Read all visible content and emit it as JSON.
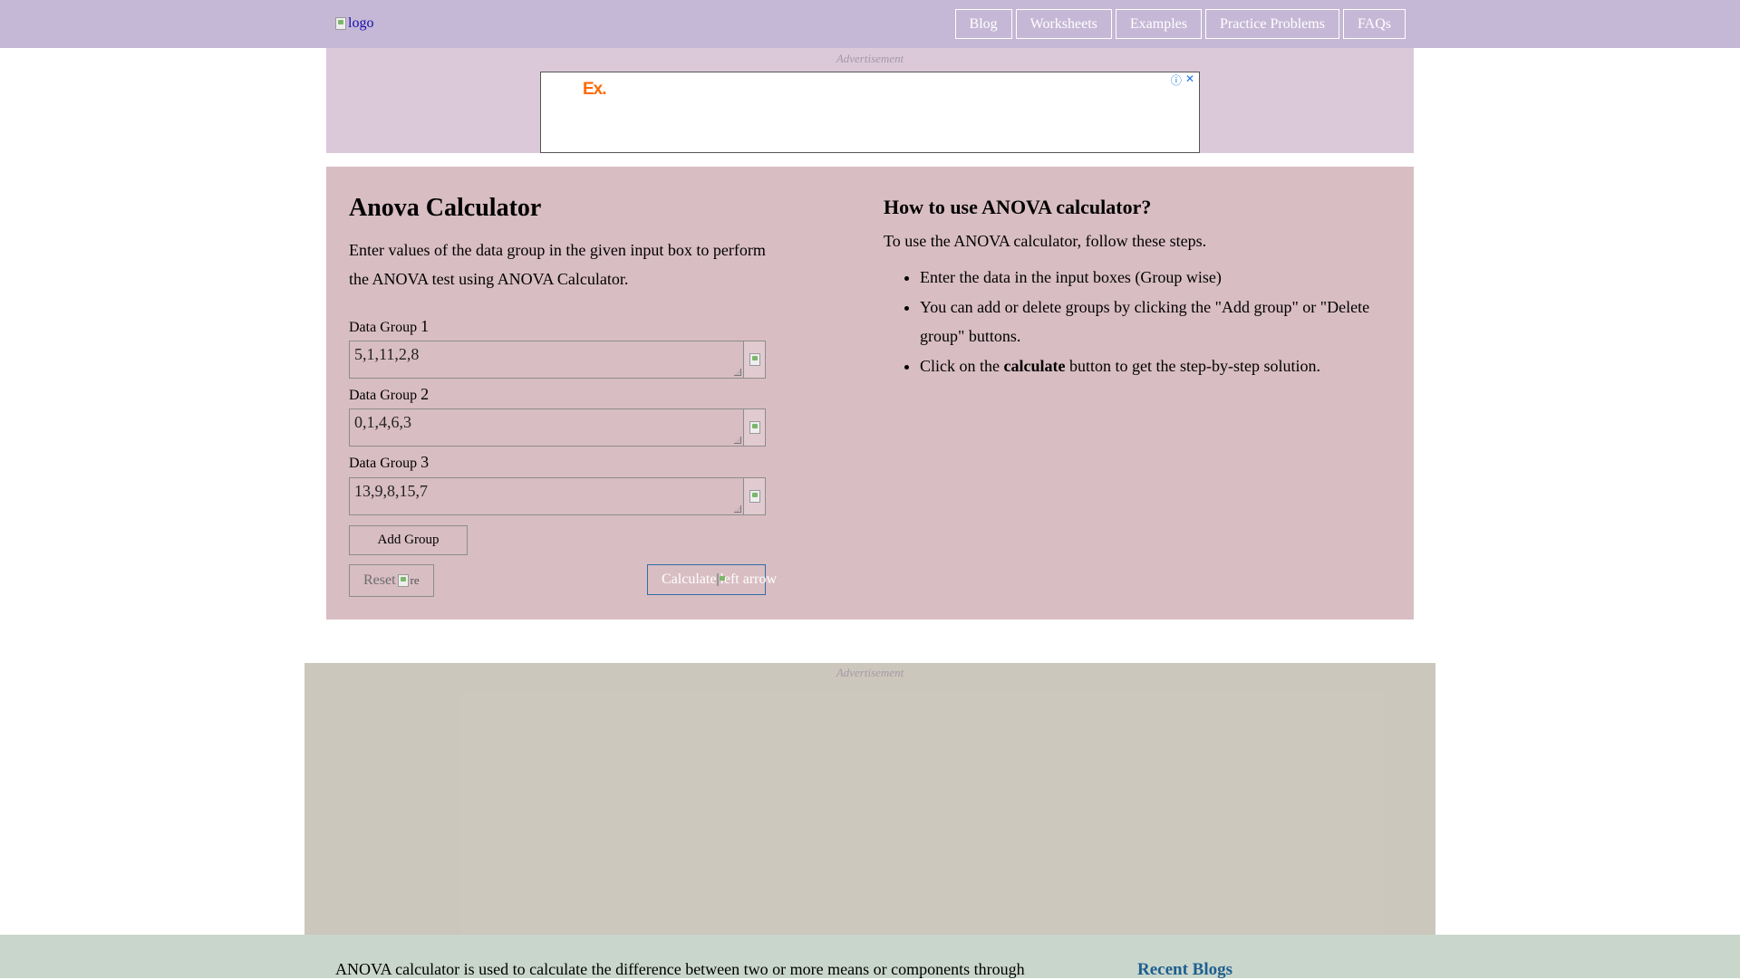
{
  "header": {
    "logo_alt": "logo",
    "nav": [
      {
        "label": "Blog"
      },
      {
        "label": "Worksheets"
      },
      {
        "label": "Examples"
      },
      {
        "label": "Practice Problems"
      },
      {
        "label": "FAQs"
      }
    ]
  },
  "top_ad": {
    "label": "Advertisement",
    "logo_text": "Ex.",
    "info_icon": "ⓘ",
    "close_icon": "✕"
  },
  "calculator": {
    "title": "Anova Calculator",
    "description": "Enter values of the data group in the given input box to perform the ANOVA test using ANOVA Calculator.",
    "group_label_prefix": "Data Group",
    "groups": [
      {
        "number": "1",
        "value": "5,1,11,2,8"
      },
      {
        "number": "2",
        "value": "0,1,4,6,3"
      },
      {
        "number": "3",
        "value": "13,9,8,15,7"
      }
    ],
    "add_group_label": "Add Group",
    "reset_label": "Reset",
    "reset_icon_alt": "re",
    "calculate_label": "Calculate",
    "calculate_icon_alt": "left arrow"
  },
  "how_to": {
    "title": "How to use ANOVA calculator?",
    "intro": "To use the ANOVA calculator, follow these steps.",
    "steps": [
      "Enter the data in the input boxes (Group wise)",
      "You can add or delete groups by clicking the \"Add group\" or \"Delete group\" buttons.",
      {
        "before": "Click on the ",
        "bold": "calculate",
        "after": " button to get the step-by-step solution."
      }
    ]
  },
  "mid_ad": {
    "label": "Advertisement"
  },
  "footer": {
    "text": "ANOVA calculator is used to calculate the difference between two or more means or components through",
    "recent_blogs": "Recent Blogs"
  },
  "colors": {
    "topbar": "#c5b8d6",
    "ad_background": "#dbc9d9",
    "calc_panel": "#d8bdc3",
    "mid_ad": "#cbc7bc",
    "footer": "#c9d6cc",
    "link": "#1f5f8f",
    "calculate_border": "#2f6fa7"
  }
}
